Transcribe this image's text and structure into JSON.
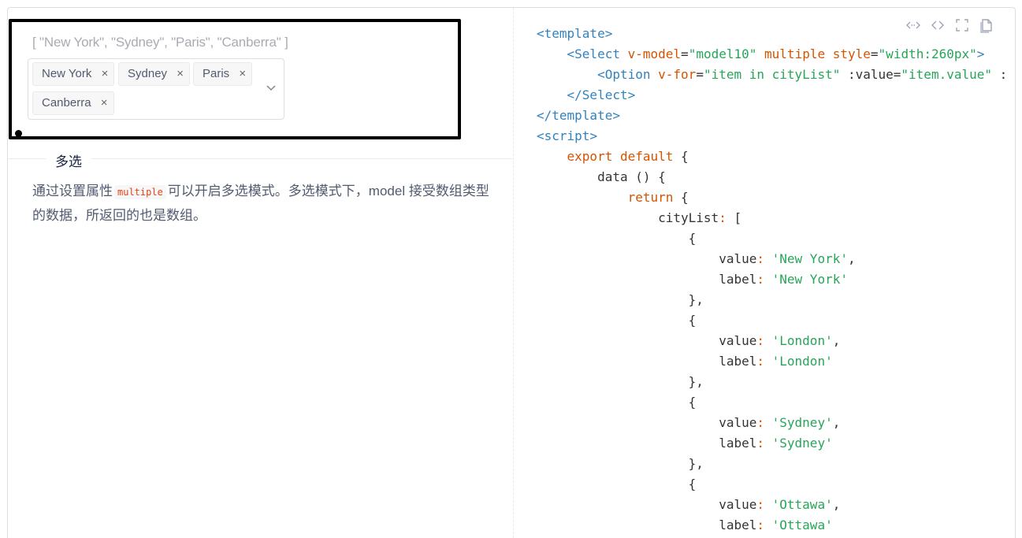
{
  "demo": {
    "model_value": "[ \"New York\", \"Sydney\", \"Paris\", \"Canberra\" ]",
    "tags": [
      {
        "label": "New York"
      },
      {
        "label": "Sydney"
      },
      {
        "label": "Paris"
      },
      {
        "label": "Canberra"
      }
    ],
    "tag_close_glyph": "×"
  },
  "section": {
    "title": "多选",
    "desc_before": "通过设置属性",
    "desc_code": "multiple",
    "desc_after": "可以开启多选模式。多选模式下，model 接受数组类型的数据，所返回的也是数组。"
  },
  "toolbar": {
    "icons": [
      "expand-code-icon",
      "code-icon",
      "fullscreen-icon",
      "copy-icon"
    ]
  },
  "code": {
    "lines": [
      "<template>",
      "    <Select v-model=\"model10\" multiple style=\"width:260px\">",
      "        <Option v-for=\"item in cityList\" :value=\"item.value\" :",
      "    </Select>",
      "</template>",
      "<script>",
      "    export default {",
      "        data () {",
      "            return {",
      "                cityList: [",
      "                    {",
      "                        value: 'New York',",
      "                        label: 'New York'",
      "                    },",
      "                    {",
      "                        value: 'London',",
      "                        label: 'London'",
      "                    },",
      "                    {",
      "                        value: 'Sydney',",
      "                        label: 'Sydney'",
      "                    },",
      "                    {",
      "                        value: 'Ottawa',",
      "                        label: 'Ottawa'"
    ]
  },
  "colors": {
    "tag": "#3182bd",
    "attr": "#d35400",
    "string": "#27a559",
    "inline_code": "#ed4014"
  }
}
